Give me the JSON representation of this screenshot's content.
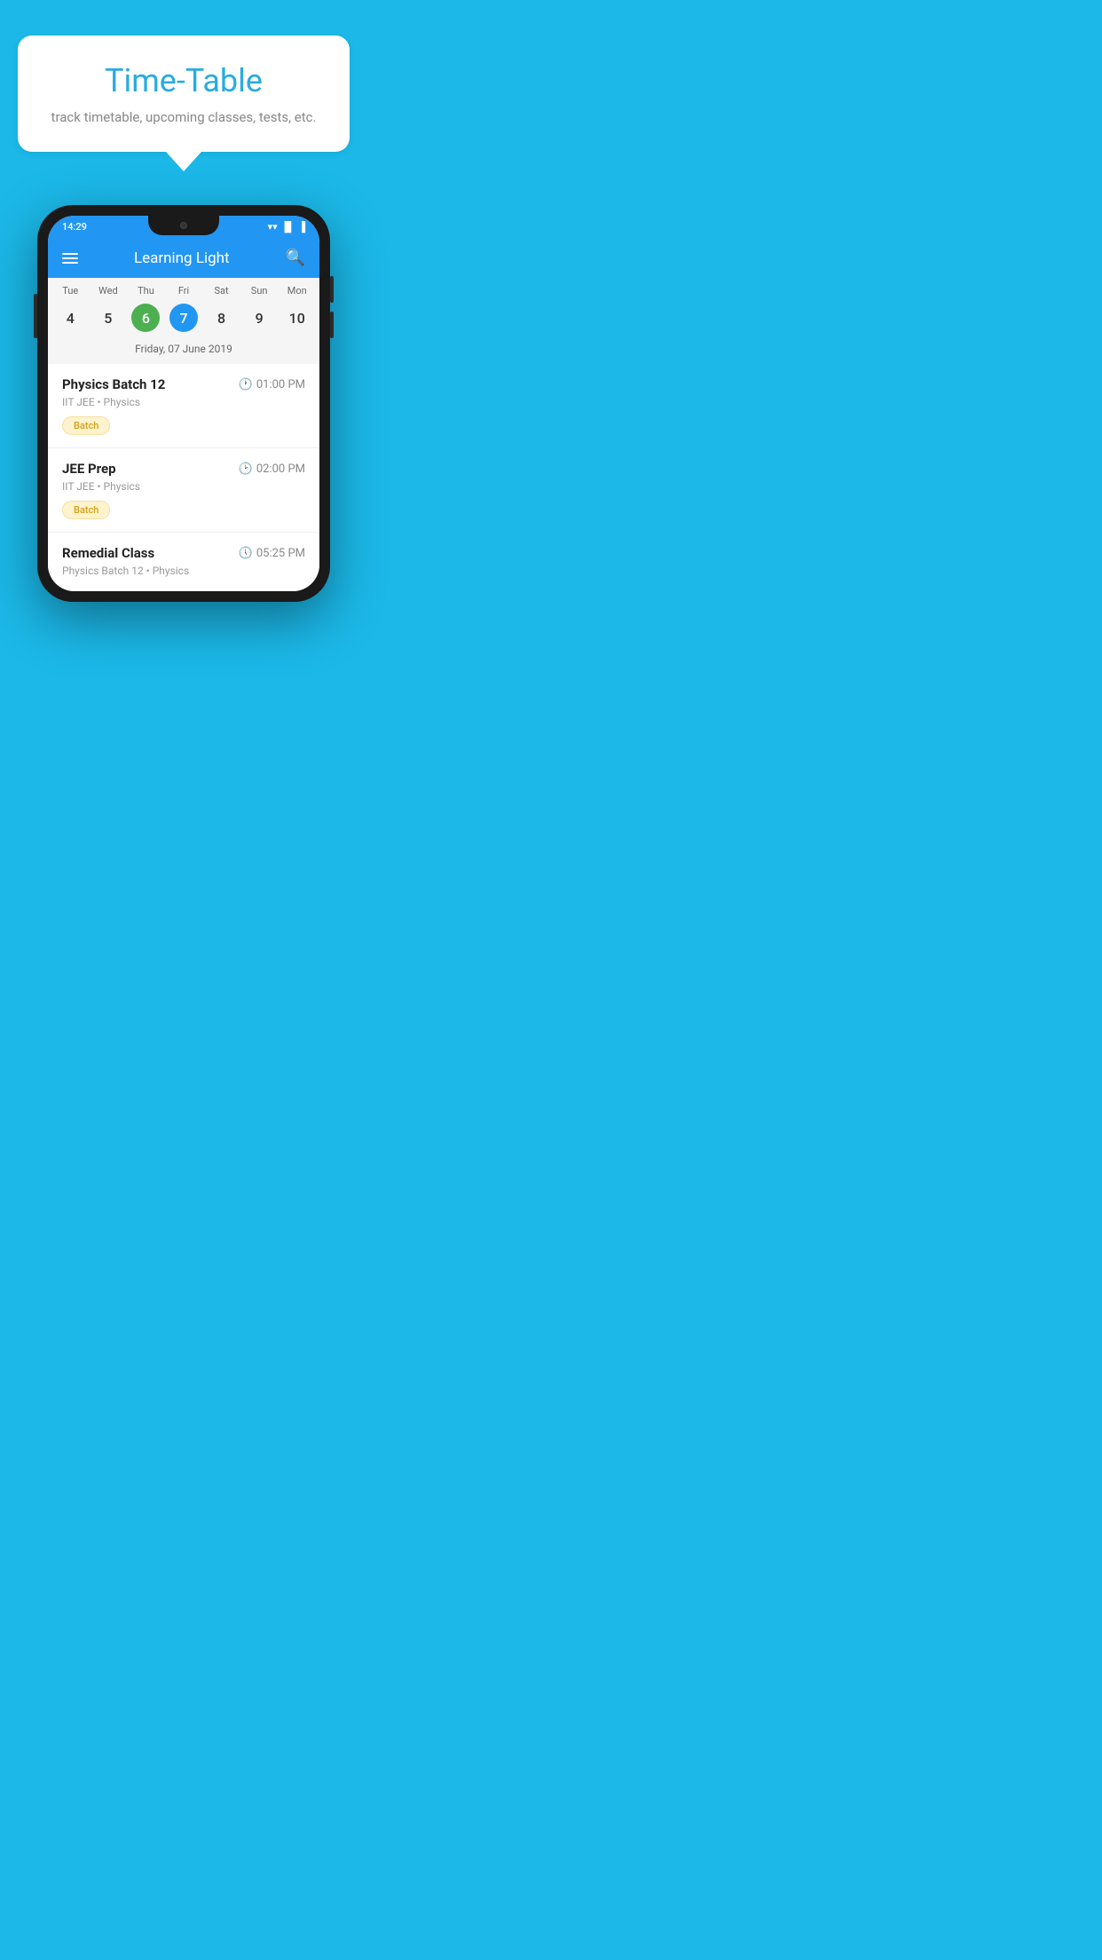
{
  "page": {
    "background_color": "#1BB8E8"
  },
  "speech_bubble": {
    "title": "Time-Table",
    "subtitle": "track timetable, upcoming classes, tests, etc."
  },
  "status_bar": {
    "time": "14:29",
    "wifi": "wifi",
    "signal": "signal",
    "battery": "battery"
  },
  "app_bar": {
    "title": "Learning Light",
    "menu_icon": "menu",
    "search_icon": "search"
  },
  "calendar": {
    "days": [
      "Tue",
      "Wed",
      "Thu",
      "Fri",
      "Sat",
      "Sun",
      "Mon"
    ],
    "dates": [
      "4",
      "5",
      "6",
      "7",
      "8",
      "9",
      "10"
    ],
    "today_index": 2,
    "selected_index": 3,
    "selected_label": "Friday, 07 June 2019"
  },
  "schedule_items": [
    {
      "title": "Physics Batch 12",
      "time": "01:00 PM",
      "subtitle": "IIT JEE • Physics",
      "badge": "Batch"
    },
    {
      "title": "JEE Prep",
      "time": "02:00 PM",
      "subtitle": "IIT JEE • Physics",
      "badge": "Batch"
    },
    {
      "title": "Remedial Class",
      "time": "05:25 PM",
      "subtitle": "Physics Batch 12 • Physics",
      "badge": null
    }
  ]
}
